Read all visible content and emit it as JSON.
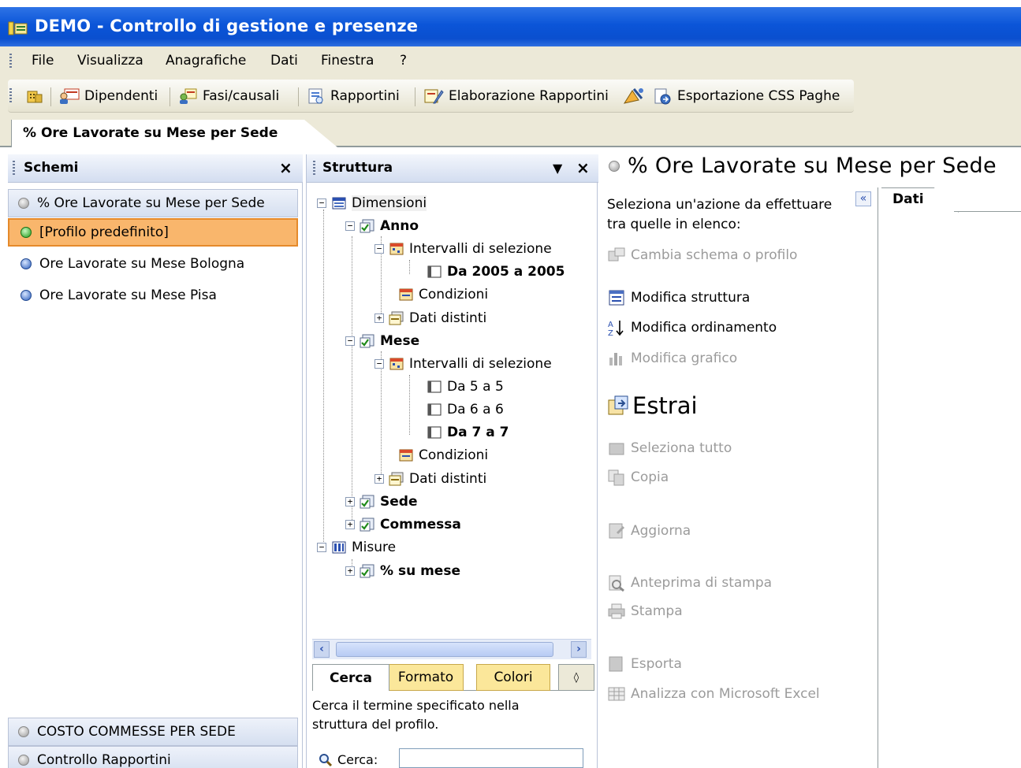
{
  "window": {
    "title": "DEMO - Controllo di gestione e presenze"
  },
  "menu": {
    "items": [
      "File",
      "Visualizza",
      "Anagrafiche",
      "Dati",
      "Finestra",
      "?"
    ]
  },
  "toolbar": {
    "dipendenti": "Dipendenti",
    "fasi": "Fasi/causali",
    "rapportini": "Rapportini",
    "elaborazione": "Elaborazione Rapportini",
    "esportazione": "Esportazione CSS Paghe"
  },
  "doc_tab": {
    "label": "% Ore Lavorate su Mese per Sede"
  },
  "schemi": {
    "title": "Schemi",
    "close": "×",
    "header_item": "% Ore Lavorate su Mese per Sede",
    "items": [
      "[Profilo predefinito]",
      "Ore Lavorate su Mese Bologna",
      "Ore Lavorate su Mese Pisa"
    ],
    "bottom_items": [
      "COSTO COMMESSE PER SEDE",
      "Controllo Rapportini"
    ]
  },
  "struttura": {
    "title": "Struttura",
    "dropdown": "▼",
    "close": "×",
    "tree": {
      "dimensioni": "Dimensioni",
      "anno": "Anno",
      "anno_intervalli": "Intervalli di selezione",
      "anno_range": "Da 2005 a 2005",
      "anno_condizioni": "Condizioni",
      "anno_dati": "Dati distinti",
      "mese": "Mese",
      "mese_intervalli": "Intervalli di selezione",
      "mese_r1": "Da 5 a 5",
      "mese_r2": "Da 6 a 6",
      "mese_r3": "Da 7 a 7",
      "mese_condizioni": "Condizioni",
      "mese_dati": "Dati distinti",
      "sede": "Sede",
      "commessa": "Commessa",
      "misure": "Misure",
      "su_mese": "% su mese"
    },
    "bottom_tabs": [
      "Cerca",
      "Formato",
      "Colori"
    ],
    "search_desc": "Cerca il termine specificato nella struttura del profilo.",
    "search_label": "Cerca:",
    "search_value": ""
  },
  "main": {
    "title": "% Ore Lavorate su Mese per Sede",
    "prompt": "Seleziona un'azione da effettuare tra quelle in elenco:",
    "collapse": "«",
    "dati_tab": "Dati",
    "actions": {
      "cambia": "Cambia schema o profilo",
      "struttura": "Modifica struttura",
      "ordinamento": "Modifica ordinamento",
      "grafico": "Modifica grafico",
      "estrai": "Estrai",
      "seleziona": "Seleziona tutto",
      "copia": "Copia",
      "aggiorna": "Aggiorna",
      "anteprima": "Anteprima di stampa",
      "stampa": "Stampa",
      "esporta": "Esporta",
      "excel": "Analizza con Microsoft Excel"
    }
  }
}
